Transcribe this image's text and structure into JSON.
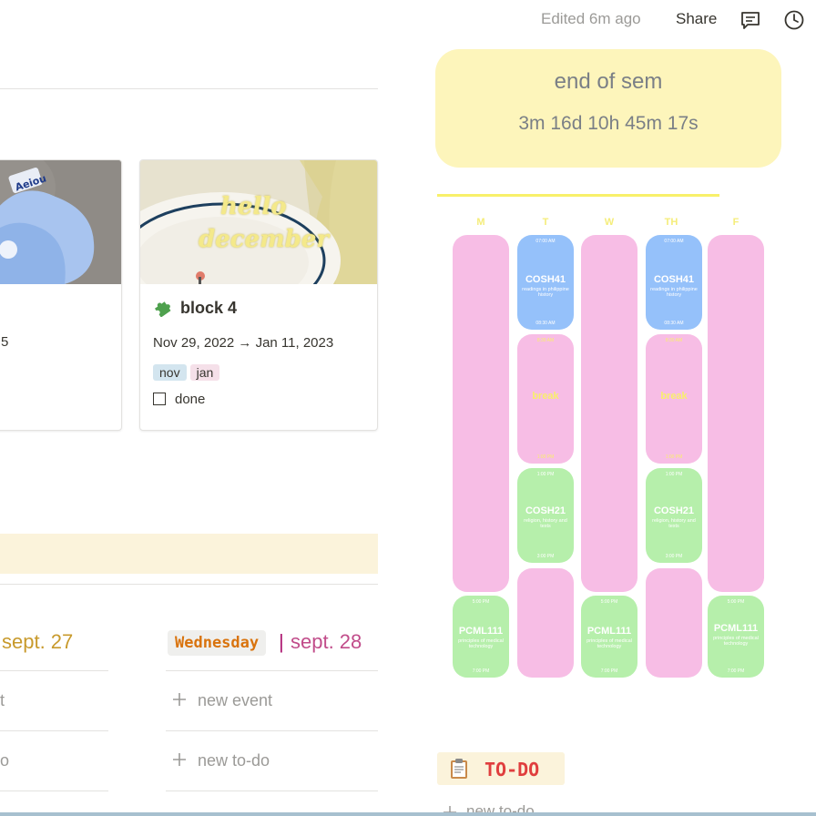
{
  "topbar": {
    "edited": "Edited 6m ago",
    "share": "Share"
  },
  "gallery": {
    "left_card": {
      "sticker_text": "Aeiou",
      "date_fragment": "5"
    },
    "card": {
      "cover_text_line1": "hello",
      "cover_text_line2": "december",
      "title": "block 4",
      "dates": "Nov 29, 2022 → Jan 11, 2023",
      "tags": [
        {
          "label": "nov",
          "color": "#d3e5ef"
        },
        {
          "label": "jan",
          "color": "#f5e0e9"
        }
      ],
      "checkbox_label": "done",
      "done": false
    }
  },
  "week": {
    "left_date": "sept. 27",
    "left_rows": [
      "t",
      "o"
    ],
    "wednesday": {
      "day": "Wednesday",
      "separator": "|",
      "date": "sept. 28",
      "new_event": "new event",
      "new_todo": "new to-do"
    }
  },
  "countdown": {
    "title": "end of sem",
    "value": "3m 16d 10h 45m 17s"
  },
  "schedule": {
    "days": [
      "M",
      "T",
      "W",
      "TH",
      "F"
    ],
    "cosh41": {
      "code": "COSH41",
      "desc": "readings in philippine history",
      "start": "07:00 AM",
      "end": "08:30 AM"
    },
    "break": {
      "label": "break",
      "start": "8:30 AM",
      "end": "1:00 PM"
    },
    "cosh21": {
      "code": "COSH21",
      "desc": "religion, history and texts",
      "start": "1:00 PM",
      "end": "3:00 PM"
    },
    "pcml111_m": {
      "code": "PCML111",
      "desc": "principles of medical technology",
      "start": "5:00 PM",
      "end": "7:00 PM"
    },
    "pcml111_w": {
      "code": "PCML111",
      "desc": "principles of medical technology",
      "start": "5:00 PM",
      "end": "7:00 PM"
    },
    "pcml111_f": {
      "code": "PCML111",
      "desc": "principles of medical technology",
      "start": "5:00 PM",
      "end": "7:00 PM"
    }
  },
  "todo": {
    "title": "TO-DO",
    "new_todo": "new to-do"
  }
}
